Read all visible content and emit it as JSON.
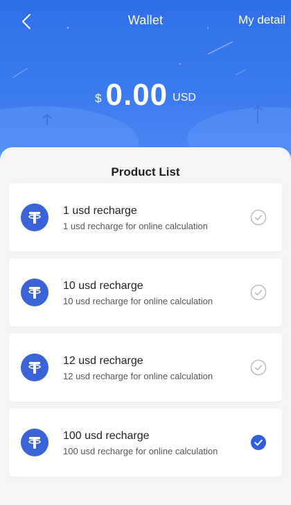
{
  "header": {
    "title": "Wallet",
    "detail_link": "My detail"
  },
  "balance": {
    "currency_symbol": "$",
    "amount": "0.00",
    "unit": "USD"
  },
  "product_list": {
    "title": "Product List",
    "items": [
      {
        "title": "1 usd recharge",
        "subtitle": "1 usd recharge for online calculation",
        "selected": false
      },
      {
        "title": "10 usd recharge",
        "subtitle": "10 usd recharge for online calculation",
        "selected": false
      },
      {
        "title": "12 usd recharge",
        "subtitle": "12 usd recharge for online calculation",
        "selected": false
      },
      {
        "title": "100 usd recharge",
        "subtitle": "100 usd recharge for online calculation",
        "selected": true
      }
    ]
  },
  "icons": {
    "back": "chevron-left-icon",
    "coin": "tether-icon",
    "check_unselected": "check-circle-outline-icon",
    "check_selected": "check-circle-filled-icon"
  },
  "colors": {
    "header_blue": "#2f6fea",
    "coin_blue": "#3a63d8",
    "selected_check": "#2f5fe0",
    "unselected_check": "#bdbdbd"
  }
}
